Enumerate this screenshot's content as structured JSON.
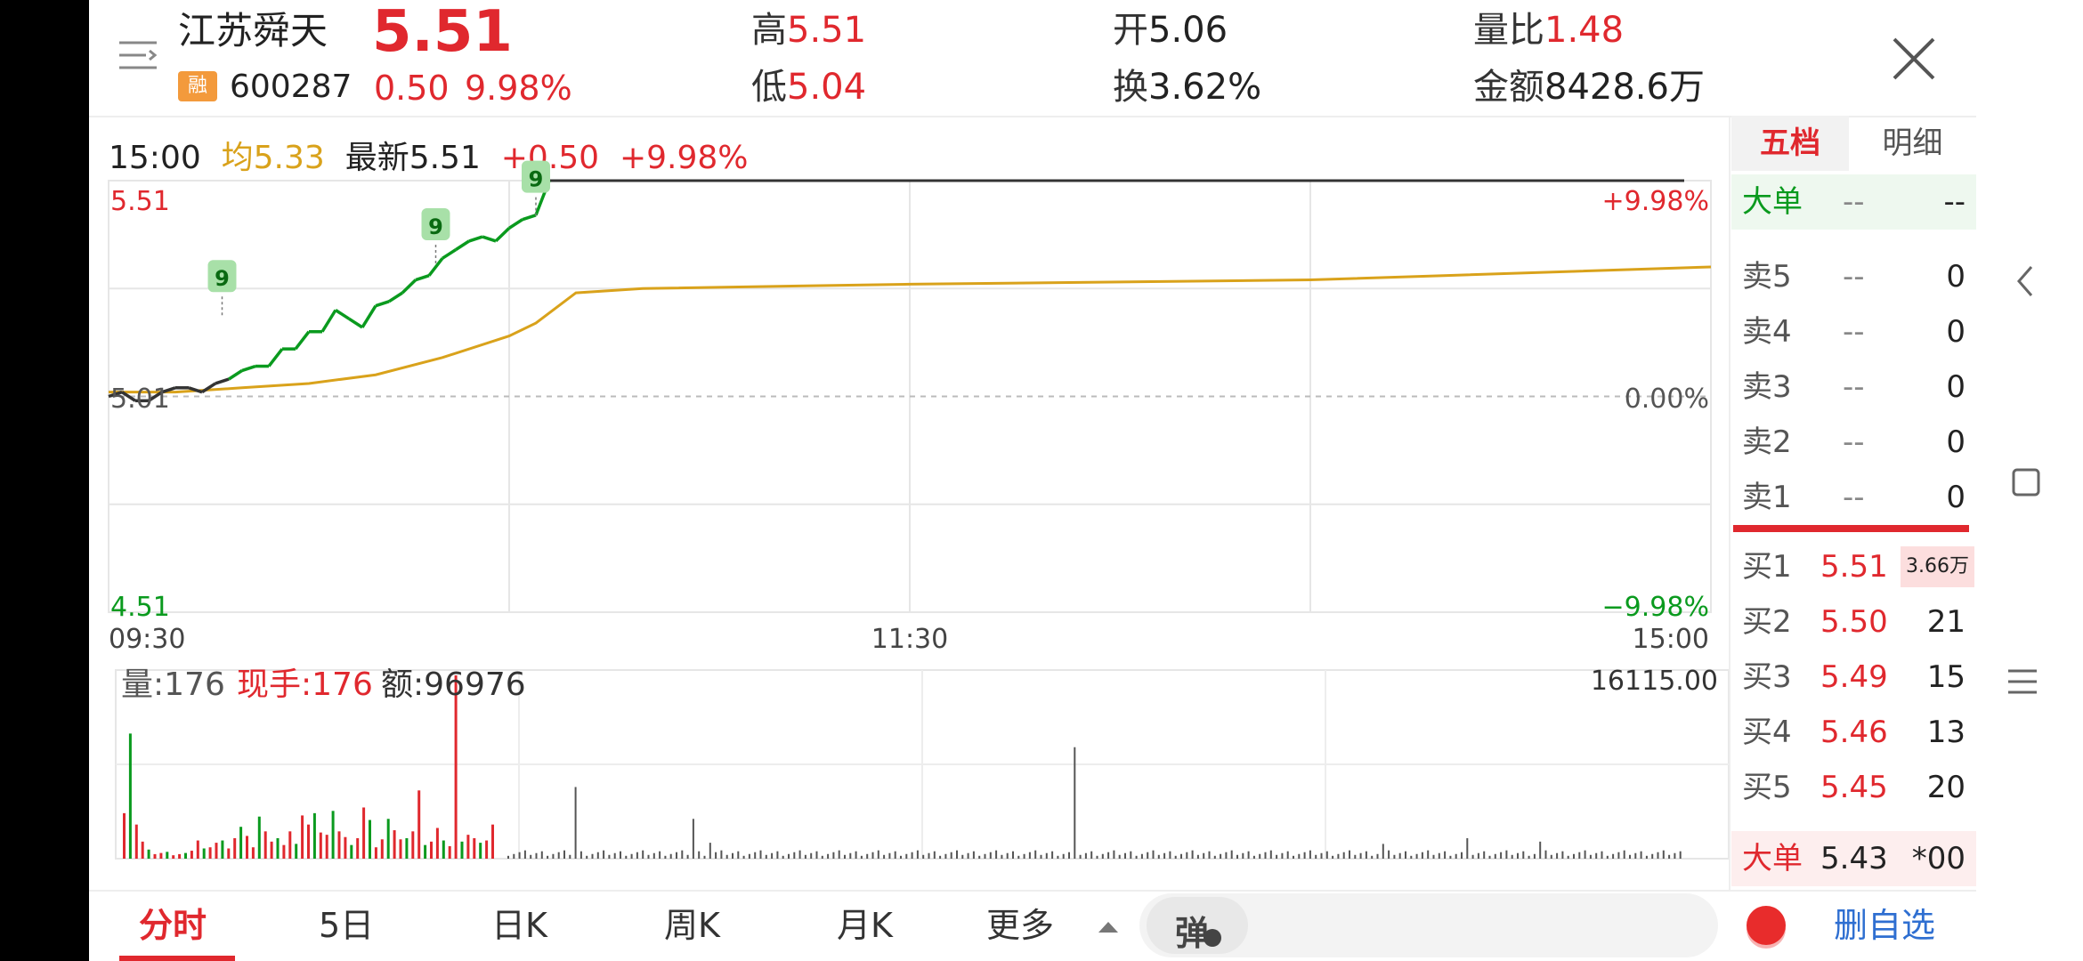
{
  "header": {
    "stock_name": "江苏舜天",
    "price": "5.51",
    "badge": "融",
    "code": "600287",
    "change": "0.50",
    "change_pct": "9.98%",
    "high_label": "高",
    "high_value": "5.51",
    "low_label": "低",
    "low_value": "5.04",
    "open_label": "开",
    "open_value": "5.06",
    "turnover_label": "换",
    "turnover_value": "3.62%",
    "volume_ratio_label": "量比",
    "volume_ratio_value": "1.48",
    "amount_label": "金额",
    "amount_value": "8428.6万"
  },
  "chart_info": {
    "time": "15:00",
    "avg_label": "均5.33",
    "latest_label": "最新5.51",
    "change": "+0.50",
    "change_pct": "+9.98%"
  },
  "chart_data": {
    "type": "line",
    "x_ticks": [
      "09:30",
      "11:30",
      "15:00"
    ],
    "y_left_ticks": [
      "5.51",
      "5.01",
      "4.51"
    ],
    "y_right_ticks": [
      "+9.98%",
      "0.00%",
      "−9.98%"
    ],
    "ylim": [
      4.51,
      5.51
    ],
    "base_price": 5.01,
    "series": [
      {
        "name": "最新",
        "x_minutes": [
          0,
          2,
          4,
          6,
          8,
          10,
          12,
          14,
          16,
          18,
          20,
          22,
          24,
          26,
          28,
          30,
          32,
          34,
          36,
          38,
          40,
          42,
          44,
          46,
          48,
          50,
          52,
          54,
          56,
          58,
          60,
          62,
          64,
          66
        ],
        "values": [
          5.01,
          5.02,
          5.0,
          5.0,
          5.02,
          5.03,
          5.03,
          5.02,
          5.04,
          5.05,
          5.07,
          5.08,
          5.08,
          5.12,
          5.12,
          5.16,
          5.16,
          5.21,
          5.19,
          5.17,
          5.22,
          5.23,
          5.25,
          5.28,
          5.29,
          5.33,
          5.35,
          5.37,
          5.38,
          5.37,
          5.4,
          5.42,
          5.43,
          5.51
        ]
      },
      {
        "name": "均",
        "x_minutes": [
          0,
          10,
          20,
          30,
          40,
          50,
          60,
          64,
          70,
          80,
          120,
          150,
          180,
          200,
          240
        ],
        "values": [
          5.02,
          5.02,
          5.03,
          5.04,
          5.06,
          5.1,
          5.15,
          5.18,
          5.25,
          5.26,
          5.27,
          5.275,
          5.28,
          5.29,
          5.31
        ]
      }
    ],
    "markers": [
      {
        "label": "9",
        "x_minute": 17,
        "value": 5.19
      },
      {
        "label": "9",
        "x_minute": 49,
        "value": 5.31
      },
      {
        "label": "9",
        "x_minute": 64,
        "value": 5.42
      }
    ]
  },
  "volume": {
    "vol_label": "量:176",
    "hand_label": "现手:176",
    "amount_label": "额:96976",
    "max_label": "16115.00",
    "chart_data": {
      "type": "bar",
      "note_values": "approximate per-minute volume, tallest = 16115",
      "values": [
        4000,
        11000,
        3000,
        1500,
        800,
        400,
        500,
        600,
        300,
        400,
        500,
        700,
        1600,
        900,
        1000,
        1400,
        1600,
        900,
        1800,
        2800,
        2000,
        1000,
        3700,
        2400,
        1500,
        1800,
        1200,
        2400,
        1300,
        3800,
        3000,
        4000,
        2300,
        2100,
        4200,
        2400,
        1900,
        1200,
        1800,
        4500,
        3400,
        1000,
        1700,
        3500,
        2500,
        1700,
        1800,
        2400,
        6000,
        1200,
        1500,
        2700,
        1600,
        1100,
        16115,
        1500,
        2100,
        1800,
        1400,
        1600,
        3000
      ]
    }
  },
  "panel": {
    "tab_five": "五档",
    "tab_detail": "明细",
    "big_order_label": "大单",
    "big_order_a": "--",
    "big_order_b": "--",
    "asks": [
      {
        "label": "卖5",
        "price": "--",
        "vol": "0"
      },
      {
        "label": "卖4",
        "price": "--",
        "vol": "0"
      },
      {
        "label": "卖3",
        "price": "--",
        "vol": "0"
      },
      {
        "label": "卖2",
        "price": "--",
        "vol": "0"
      },
      {
        "label": "卖1",
        "price": "--",
        "vol": "0"
      }
    ],
    "bids": [
      {
        "label": "买1",
        "price": "5.51",
        "vol": "3.66万"
      },
      {
        "label": "买2",
        "price": "5.50",
        "vol": "21"
      },
      {
        "label": "买3",
        "price": "5.49",
        "vol": "15"
      },
      {
        "label": "买4",
        "price": "5.46",
        "vol": "13"
      },
      {
        "label": "买5",
        "price": "5.45",
        "vol": "20"
      }
    ],
    "big_order2_label": "大单",
    "big_order2_price": "5.43",
    "big_order2_vol": "*00"
  },
  "bottom": {
    "tabs": [
      "分时",
      "5日",
      "日K",
      "周K",
      "月K",
      "更多"
    ],
    "danmu_label": "弹",
    "remove_label": "删自选"
  },
  "colors": {
    "up": "#e0282e",
    "down": "#0a9a1e",
    "avg": "#d9a21b",
    "accent_blue": "#2f6fd1"
  }
}
